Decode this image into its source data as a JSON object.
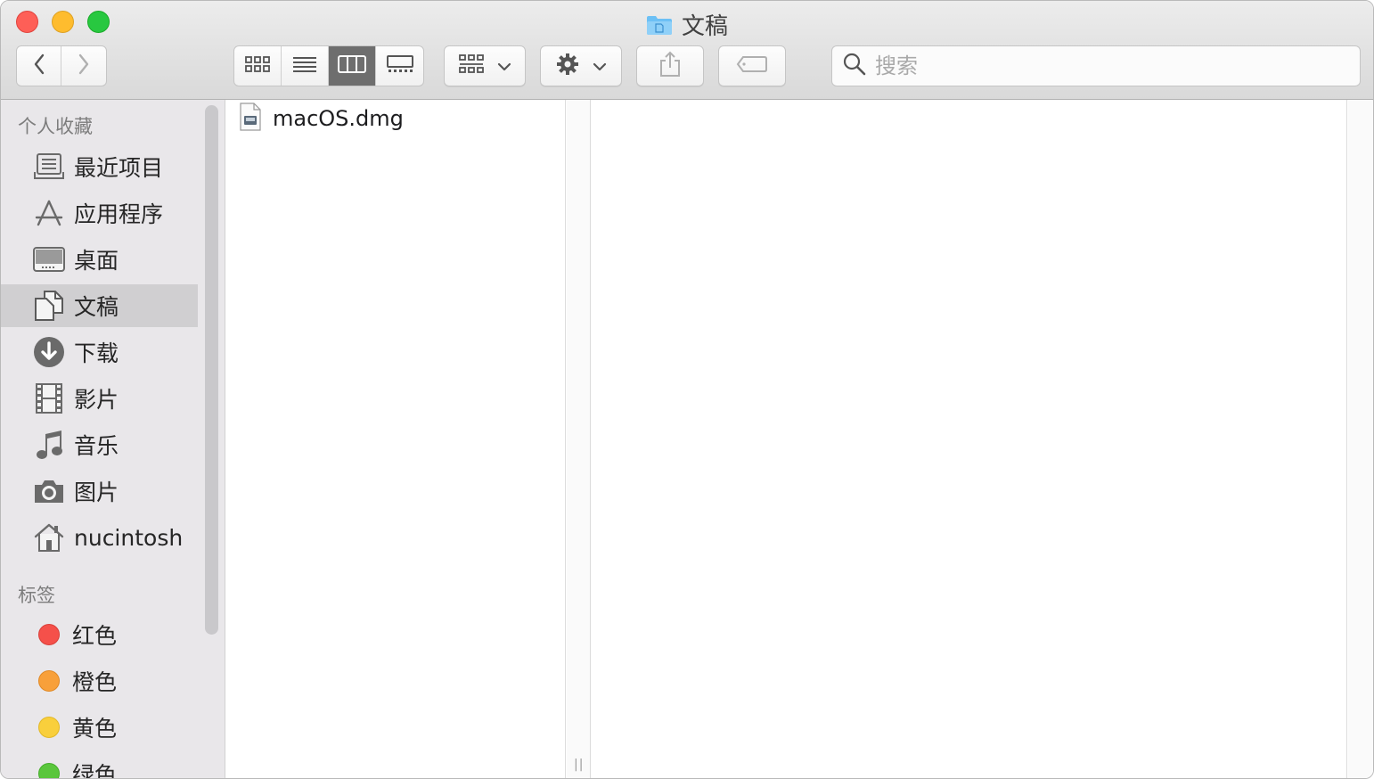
{
  "window": {
    "title": "文稿",
    "title_icon": "folder-icon"
  },
  "toolbar": {
    "back_icon": "chevron-left-icon",
    "forward_icon": "chevron-right-icon",
    "view_modes": [
      "icon-view",
      "list-view",
      "column-view",
      "gallery-view"
    ],
    "active_view": "column-view",
    "group_icon": "group-by-icon",
    "action_icon": "gear-icon",
    "share_icon": "share-icon",
    "tag_icon": "tag-icon",
    "search_placeholder": "搜索"
  },
  "sidebar": {
    "favorites_header": "个人收藏",
    "favorites": [
      {
        "label": "最近项目",
        "icon": "recents-icon"
      },
      {
        "label": "应用程序",
        "icon": "applications-icon"
      },
      {
        "label": "桌面",
        "icon": "desktop-icon"
      },
      {
        "label": "文稿",
        "icon": "documents-icon",
        "selected": true
      },
      {
        "label": "下载",
        "icon": "downloads-icon"
      },
      {
        "label": "影片",
        "icon": "movies-icon"
      },
      {
        "label": "音乐",
        "icon": "music-icon"
      },
      {
        "label": "图片",
        "icon": "pictures-icon"
      },
      {
        "label": "nucintosh",
        "icon": "home-icon"
      }
    ],
    "tags_header": "标签",
    "tags": [
      {
        "label": "红色",
        "color": "#f5504a"
      },
      {
        "label": "橙色",
        "color": "#f8a03a"
      },
      {
        "label": "黄色",
        "color": "#f9cf3c"
      },
      {
        "label": "绿色",
        "color": "#5ac63c"
      }
    ]
  },
  "files": [
    {
      "name": "macOS.dmg",
      "icon": "disk-image-icon"
    }
  ],
  "colors": {
    "accent_folder": "#6cc0f5",
    "selection": "#d0cfd1"
  }
}
